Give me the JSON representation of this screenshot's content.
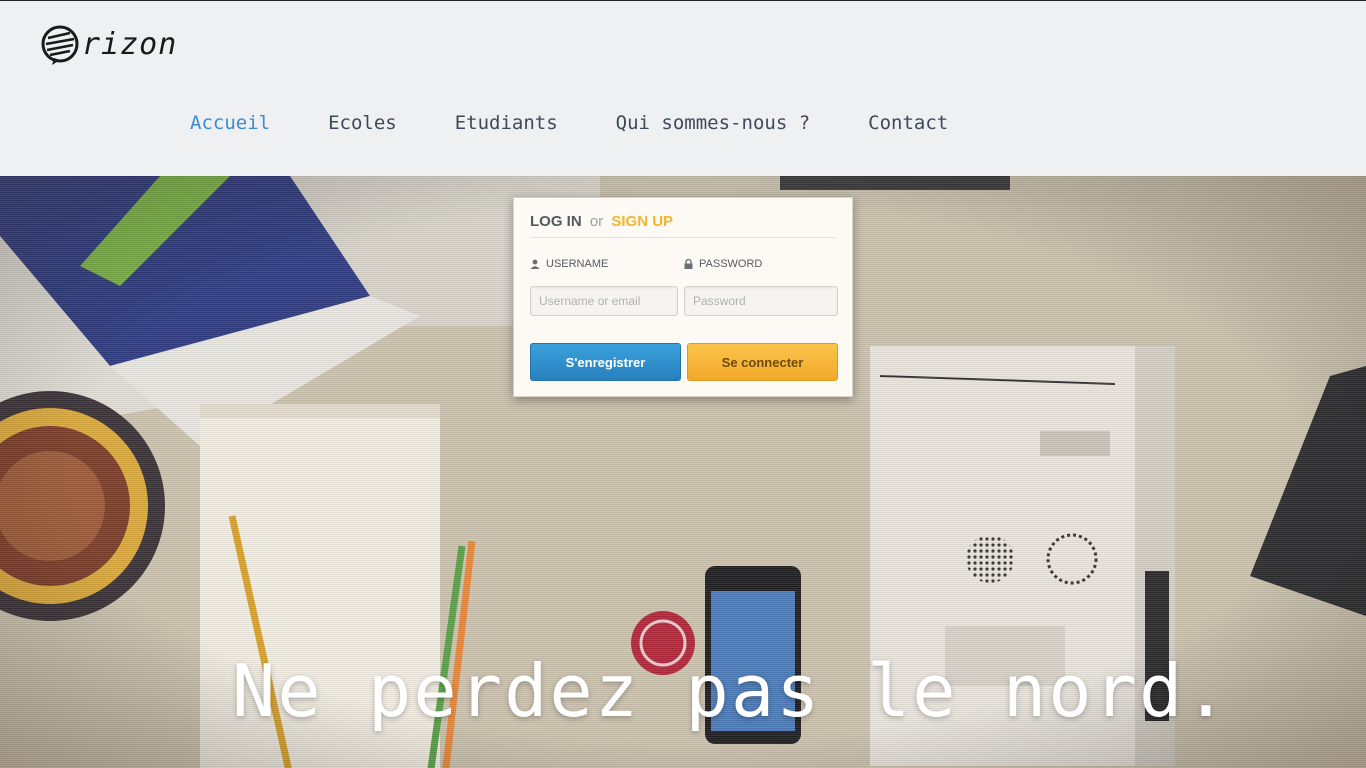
{
  "header": {
    "logo_text": "rizon"
  },
  "nav": {
    "items": [
      {
        "label": "Accueil",
        "active": true
      },
      {
        "label": "Ecoles",
        "active": false
      },
      {
        "label": "Etudiants",
        "active": false
      },
      {
        "label": "Qui sommes-nous ?",
        "active": false
      },
      {
        "label": "Contact",
        "active": false
      }
    ]
  },
  "login": {
    "title_login": "LOG IN",
    "title_or": "or",
    "title_signup": "SIGN UP",
    "username_label": "USERNAME",
    "password_label": "PASSWORD",
    "username_placeholder": "Username or email",
    "password_placeholder": "Password",
    "register_button": "S'enregistrer",
    "connect_button": "Se connecter"
  },
  "hero": {
    "tagline": "Ne perdez pas le nord."
  },
  "colors": {
    "nav_active": "#3b8ed0",
    "nav_default": "#3e4a5a",
    "signup_accent": "#f2b632",
    "register_blue": "#2e8fcf",
    "connect_orange": "#f7b83b"
  }
}
